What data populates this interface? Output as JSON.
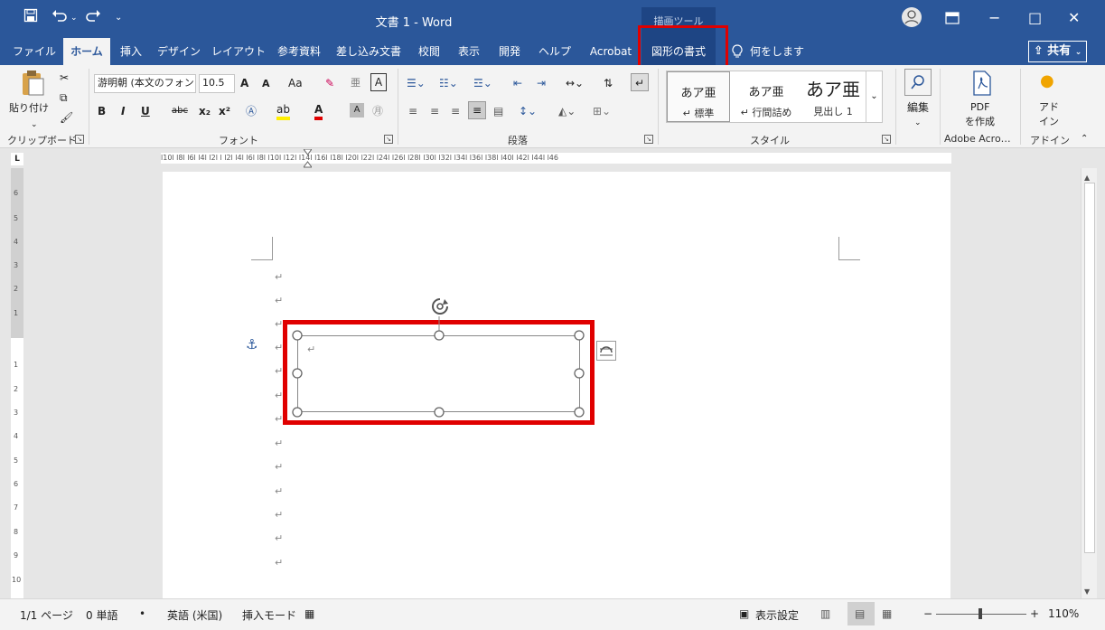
{
  "titlebar": {
    "save_icon": "save-icon",
    "undo_icon": "undo-icon",
    "redo_icon": "redo-icon",
    "title": "文書 1 - Word",
    "drawing_tools": "描画ツール",
    "minimize": "−",
    "maximize": "□",
    "close": "✕"
  },
  "tabs": [
    "ファイル",
    "ホーム",
    "挿入",
    "デザイン",
    "レイアウト",
    "参考資料",
    "差し込み文書",
    "校閲",
    "表示",
    "開発",
    "ヘルプ",
    "Acrobat",
    "図形の書式"
  ],
  "tell_me": "何をしますか",
  "share": "共有",
  "ribbon": {
    "clipboard": {
      "paste": "貼り付け",
      "label": "クリップボード"
    },
    "font": {
      "name": "游明朝 (本文のフォン",
      "size": "10.5",
      "grow": "A",
      "shrink": "A",
      "case": "Aa",
      "clear": "A",
      "bold": "B",
      "italic": "I",
      "underline": "U",
      "strike": "abc",
      "sub": "x₂",
      "sup": "x²",
      "color_a": "A",
      "label": "フォント"
    },
    "paragraph": {
      "label": "段落"
    },
    "styles": {
      "items": [
        {
          "big": "あア亜",
          "sm": "↵ 標準"
        },
        {
          "big": "あア亜",
          "sm": "↵ 行間詰め"
        },
        {
          "big": "あア亜",
          "sm": "見出し 1"
        }
      ],
      "label": "スタイル"
    },
    "editing": {
      "label": "編集"
    },
    "pdf": {
      "line1": "PDF",
      "line2": "を作成",
      "group": "Adobe Acro…"
    },
    "addin": {
      "line1": "アド",
      "line2": "イン",
      "group": "アドイン"
    }
  },
  "ruler_text": "l10l l8l l6l l4l l2l l   l2l l4l l6l l8l l10l l12l l14l l16l l18l l20l l22l l24l l26l l28l l30l l32l l34l l36l l38l l40l l42l l44l l46",
  "ruler_corner": "L",
  "para_mark": "↵",
  "anchor": "⚓",
  "status": {
    "page": "1/1 ページ",
    "words": "0 単語",
    "lang": "英語 (米国)",
    "mode": "挿入モード",
    "display": "表示設定",
    "zoom": "110%",
    "minus": "−",
    "plus": "+"
  },
  "colors": {
    "brand": "#2b579a",
    "highlight": "#e00000"
  }
}
